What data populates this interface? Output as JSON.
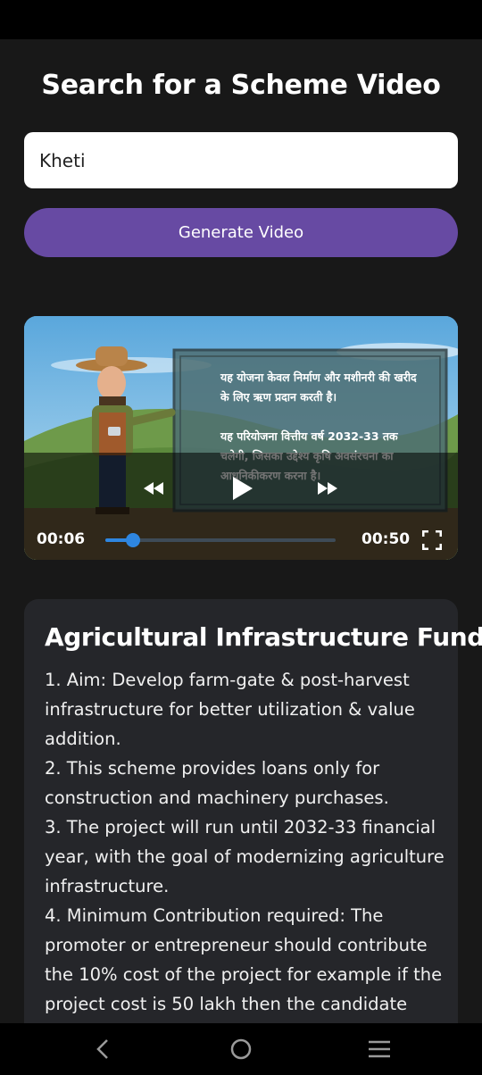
{
  "page": {
    "title": "Search for a Scheme Video"
  },
  "search": {
    "value": "Kheti"
  },
  "generate_button": {
    "label": "Generate Video"
  },
  "video": {
    "hindi_line_1": "यह योजना केवल निर्माण और मशीनरी की खरीद के लिए ऋण प्रदान करती है।",
    "hindi_line_2": "यह परियोजना वित्तीय वर्ष 2032-33 तक चलेगी, जिसका उद्देश्य कृषि अवसंरचना का आधुनिकीकरण करना है।",
    "current_time": "00:06",
    "duration": "00:50",
    "progress_fraction": 0.12
  },
  "scheme": {
    "title": "Agricultural Infrastructure Fund",
    "points": [
      "1. Aim: Develop farm-gate & post-harvest infrastructure for better utilization & value addition.",
      "2. This scheme provides loans only for construction and machinery purchases.",
      "3. The project will run until 2032-33 financial year, with the goal of modernizing agriculture infrastructure.",
      "4. Minimum Contribution required: The promoter or entrepreneur should contribute the 10% cost of the project for example if the project cost is 50 lakh then the candidate"
    ]
  },
  "colors": {
    "background": "#181818",
    "accent": "#674aa3",
    "card": "#25262a",
    "seek": "#2e86e0"
  },
  "icons": [
    "rewind-icon",
    "play-icon",
    "fast-forward-icon",
    "fullscreen-icon",
    "back-icon",
    "home-icon",
    "menu-icon"
  ]
}
